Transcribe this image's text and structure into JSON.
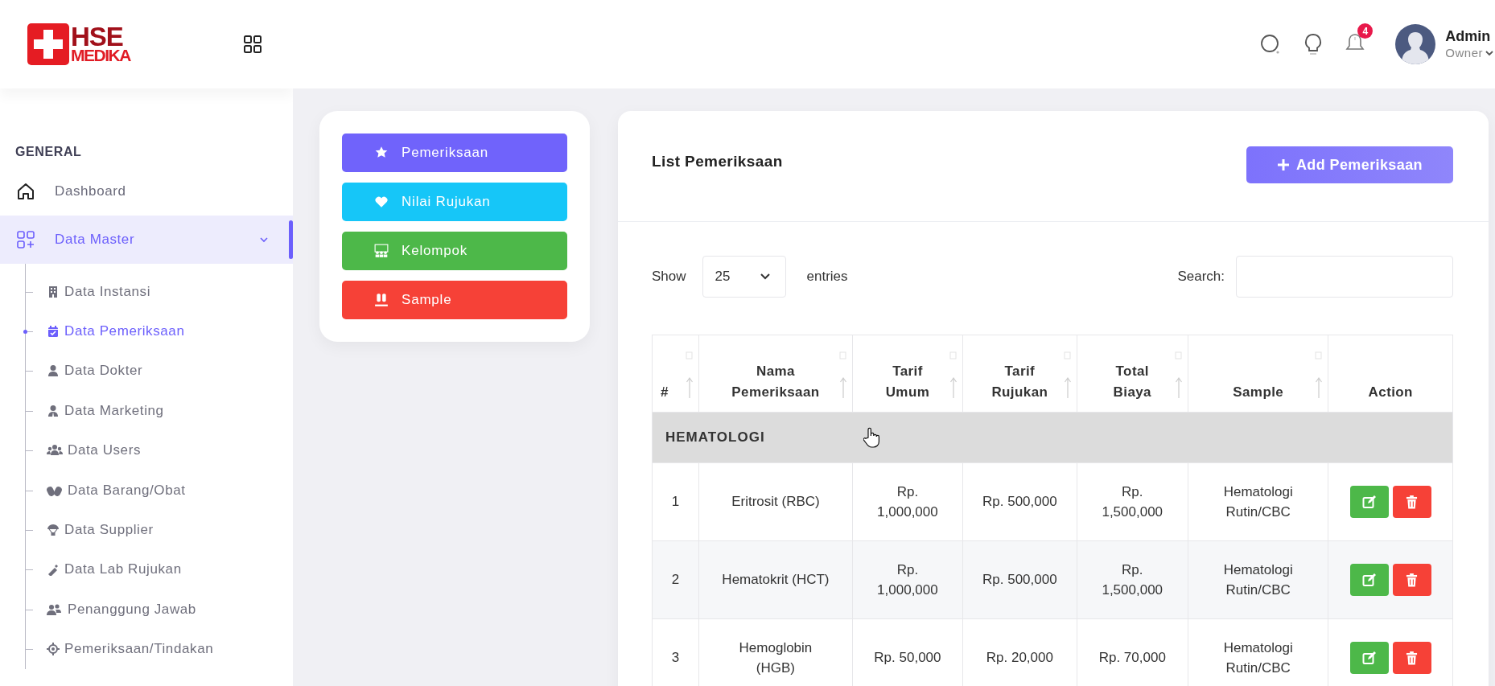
{
  "logo": {
    "top": "HSE",
    "bottom": "MEDIKA"
  },
  "topbar": {
    "notification_count": "4",
    "user_name": "Admin",
    "user_role": "Owner"
  },
  "sidebar": {
    "section": "GENERAL",
    "items": [
      {
        "label": "Dashboard",
        "selected": false
      },
      {
        "label": "Data Master",
        "selected": true,
        "expanded": true,
        "children": [
          {
            "label": "Data Instansi",
            "selected": false
          },
          {
            "label": "Data Pemeriksaan",
            "selected": true
          },
          {
            "label": "Data Dokter",
            "selected": false
          },
          {
            "label": "Data Marketing",
            "selected": false
          },
          {
            "label": "Data Users",
            "selected": false
          },
          {
            "label": "Data Barang/Obat",
            "selected": false
          },
          {
            "label": "Data Supplier",
            "selected": false
          },
          {
            "label": "Data Lab Rujukan",
            "selected": false
          },
          {
            "label": "Penanggung Jawab",
            "selected": false
          },
          {
            "label": "Pemeriksaan/Tindakan",
            "selected": false
          }
        ]
      }
    ]
  },
  "menu_buttons": [
    {
      "label": "Pemeriksaan",
      "color": "#7063fb"
    },
    {
      "label": "Nilai Rujukan",
      "color": "#16c6f8"
    },
    {
      "label": "Kelompok",
      "color": "#4db849"
    },
    {
      "label": "Sample",
      "color": "#f64137"
    }
  ],
  "list": {
    "title": "List Pemeriksaan",
    "add_button": "Add Pemeriksaan",
    "show_label": "Show",
    "entries_value": "25",
    "entries_label": "entries",
    "search_label": "Search:",
    "table": {
      "columns": [
        {
          "label": "#",
          "sortable": true
        },
        {
          "label": "Nama Pemeriksaan",
          "sortable": true
        },
        {
          "label": "Tarif Umum",
          "sortable": true
        },
        {
          "label": "Tarif Rujukan",
          "sortable": true
        },
        {
          "label": "Total Biaya",
          "sortable": true
        },
        {
          "label": "Sample",
          "sortable": true
        },
        {
          "label": "Action",
          "sortable": false
        }
      ],
      "rows": [
        {
          "kind": "group",
          "label": "HEMATOLOGI"
        },
        {
          "kind": "item",
          "cells": [
            "1",
            "Eritrosit (RBC)",
            "Rp. 1,000,000",
            "Rp. 500,000",
            "Rp. 1,500,000",
            "Hematologi Rutin/CBC"
          ]
        },
        {
          "kind": "item",
          "cells": [
            "2",
            "Hematokrit (HCT)",
            "Rp. 1,000,000",
            "Rp. 500,000",
            "Rp. 1,500,000",
            "Hematologi Rutin/CBC"
          ]
        },
        {
          "kind": "item",
          "cells": [
            "3",
            "Hemoglobin (HGB)",
            "Rp. 50,000",
            "Rp. 20,000",
            "Rp. 70,000",
            "Hematologi Rutin/CBC"
          ]
        }
      ]
    }
  }
}
